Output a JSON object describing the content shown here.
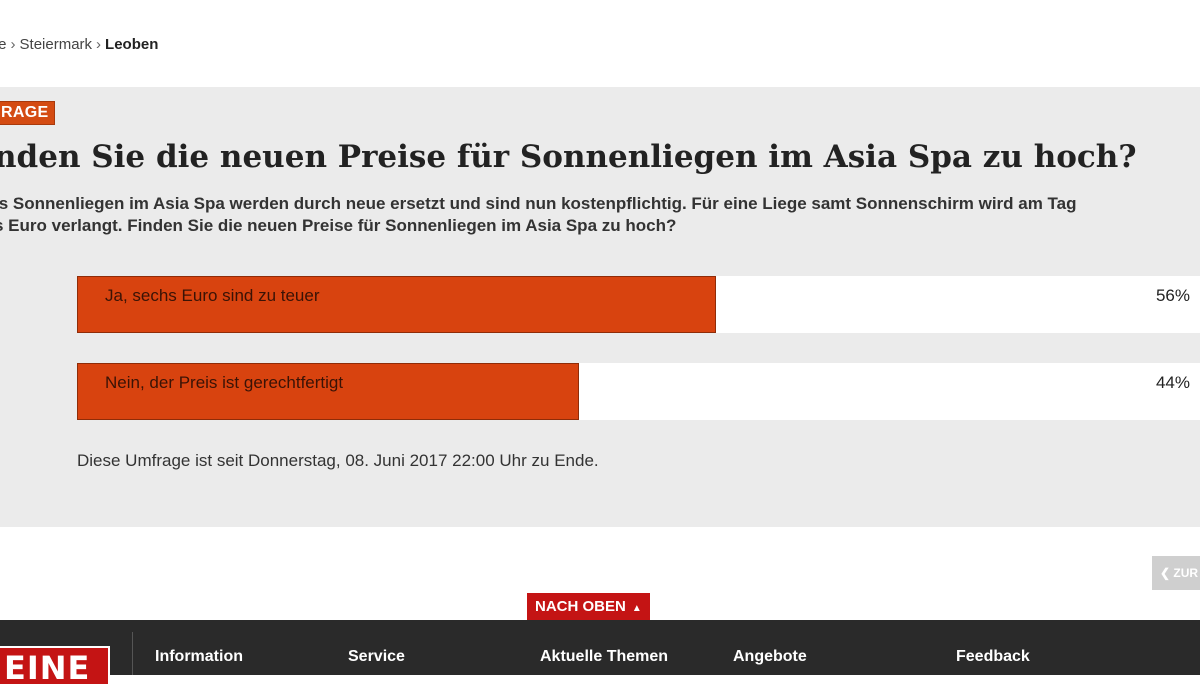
{
  "breadcrumb": {
    "items": [
      {
        "label": "te"
      },
      {
        "label": "Steiermark"
      }
    ],
    "current": "Leoben"
  },
  "poll": {
    "badge": "RAGE",
    "title": "nden Sie die neuen Preise für Sonnenliegen im Asia Spa zu hoch?",
    "intro_line1": "is Sonnenliegen im Asia Spa werden durch neue ersetzt und sind nun kostenpflichtig. Für eine Liege samt Sonnenschirm wird am Tag",
    "intro_line2": "s Euro verlangt. Finden Sie die neuen Preise für Sonnenliegen im Asia Spa zu hoch?",
    "options": [
      {
        "label": "Ja, sechs Euro sind zu teuer",
        "percent_label": "56%",
        "fill_fraction": 0.569
      },
      {
        "label": "Nein, der Preis ist gerechtfertigt",
        "percent_label": "44%",
        "fill_fraction": 0.447
      }
    ],
    "status": "Diese Umfrage ist seit Donnerstag, 08. Juni 2017 22:00 Uhr zu Ende.",
    "bar_color": "#d8430f"
  },
  "back_button": {
    "label": "ZUR",
    "icon": "chevron-left-icon"
  },
  "to_top": {
    "label": "NACH OBEN",
    "icon": "caret-up-icon"
  },
  "footer": {
    "logo_text": "EINE",
    "links": [
      "Information",
      "Service",
      "Aktuelle Themen",
      "Angebote",
      "Feedback"
    ]
  }
}
